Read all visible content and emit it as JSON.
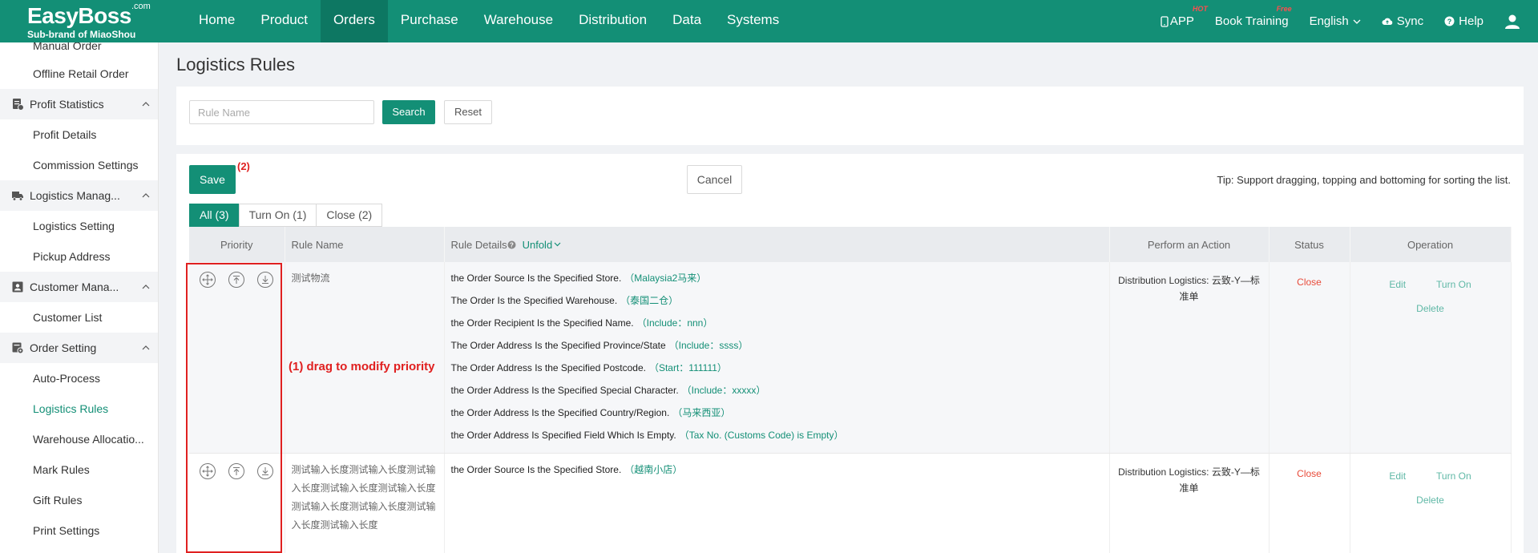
{
  "header": {
    "brand": "EasyBoss",
    "brand_suffix": ".com",
    "sub_brand": "Sub-brand of MiaoShou",
    "nav": [
      {
        "label": "Home"
      },
      {
        "label": "Product"
      },
      {
        "label": "Orders"
      },
      {
        "label": "Purchase"
      },
      {
        "label": "Warehouse"
      },
      {
        "label": "Distribution"
      },
      {
        "label": "Data"
      },
      {
        "label": "Systems"
      }
    ],
    "app": "APP",
    "app_badge": "HOT",
    "training": "Book Training",
    "training_badge": "Free",
    "language": "English",
    "sync": "Sync",
    "help": "Help",
    "color": "#138f76"
  },
  "sidebar": {
    "items": [
      {
        "label": "Manual Order"
      },
      {
        "label": "Offline Retail Order"
      },
      {
        "label": "Profit Statistics"
      },
      {
        "label": "Profit Details"
      },
      {
        "label": "Commission Settings"
      },
      {
        "label": "Logistics Manag..."
      },
      {
        "label": "Logistics Setting"
      },
      {
        "label": "Pickup Address"
      },
      {
        "label": "Customer Mana..."
      },
      {
        "label": "Customer List"
      },
      {
        "label": "Order Setting"
      },
      {
        "label": "Auto-Process"
      },
      {
        "label": "Logistics Rules"
      },
      {
        "label": "Warehouse Allocatio..."
      },
      {
        "label": "Mark Rules"
      },
      {
        "label": "Gift Rules"
      },
      {
        "label": "Print Settings"
      }
    ]
  },
  "page": {
    "title": "Logistics Rules",
    "search_placeholder": "Rule Name",
    "search_btn": "Search",
    "reset_btn": "Reset",
    "save_btn": "Save",
    "cancel_btn": "Cancel",
    "tip": "Tip: Support dragging, topping and bottoming for sorting the list.",
    "annotation_2": "(2)",
    "annotation_1": "(1) drag to modify priority",
    "tabs": [
      {
        "label": "All (3)"
      },
      {
        "label": "Turn On (1)"
      },
      {
        "label": "Close (2)"
      }
    ]
  },
  "table": {
    "headers": {
      "priority": "Priority",
      "rule_name": "Rule Name",
      "rule_details": "Rule Details",
      "unfold": "Unfold",
      "action": "Perform an Action",
      "status": "Status",
      "operation": "Operation"
    },
    "rows": [
      {
        "name": "测试物流",
        "details": [
          {
            "cond": "the Order Source Is the Specified Store.",
            "val": "（Malaysia2马来）"
          },
          {
            "cond": "The Order Is the Specified Warehouse.",
            "val": "（泰国二仓）"
          },
          {
            "cond": "the Order Recipient Is the Specified Name.",
            "val": "（Include：nnn）"
          },
          {
            "cond": "The Order Address Is the Specified Province/State",
            "val": "（Include：ssss）"
          },
          {
            "cond": "The Order Address Is the Specified Postcode.",
            "val": "（Start：111111）"
          },
          {
            "cond": "the Order Address Is the Specified Special Character.",
            "val": "（Include：xxxxx）"
          },
          {
            "cond": "the Order Address Is the Specified Country/Region.",
            "val": "（马来西亚）"
          },
          {
            "cond": "the Order Address Is Specified Field Which Is Empty.",
            "val": "（Tax No. (Customs Code) is Empty）"
          }
        ],
        "action_label": "Distribution Logistics:",
        "action_value": "云致-Y—标准单",
        "status": "Close",
        "ops": {
          "edit": "Edit",
          "turn_on": "Turn On",
          "delete": "Delete"
        }
      },
      {
        "name": "测试输入长度测试输入长度测试输入长度测试输入长度测试输入长度测试输入长度测试输入长度测试输入长度测试输入长度",
        "details": [
          {
            "cond": "the Order Source Is the Specified Store.",
            "val": "（越南小店）"
          }
        ],
        "action_label": "Distribution Logistics:",
        "action_value": "云致-Y—标准单",
        "status": "Close",
        "ops": {
          "edit": "Edit",
          "turn_on": "Turn On",
          "delete": "Delete"
        }
      }
    ]
  }
}
